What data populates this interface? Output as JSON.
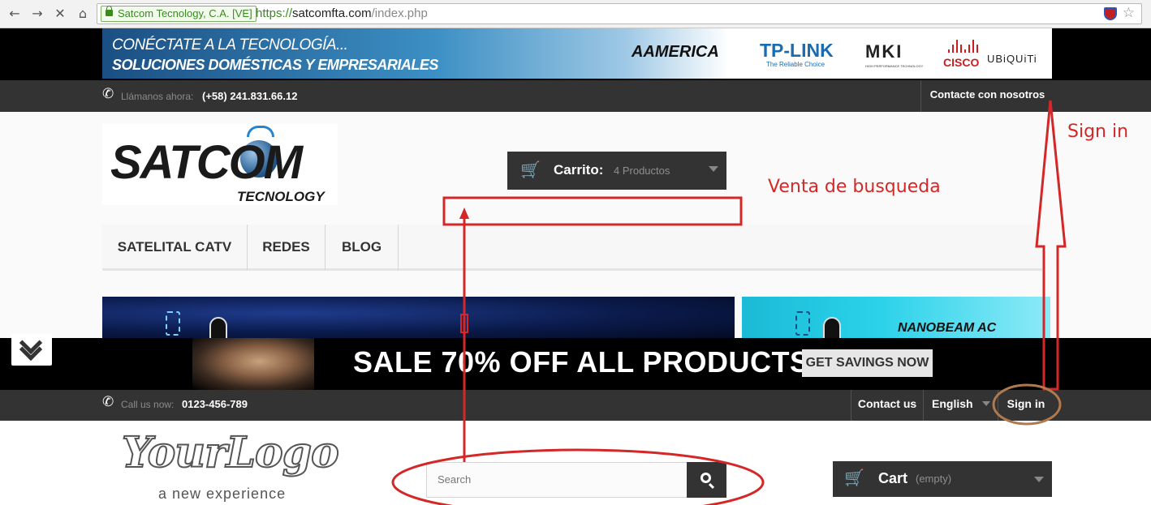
{
  "browser": {
    "ev_cert": "Satcom Tecnology, C.A. [VE]",
    "url_scheme": "https://",
    "url_host": "satcomfta.com",
    "url_path": "/index.php"
  },
  "site_live": {
    "promo_banner": {
      "tagline_1": "CONÉCTATE A LA TECNOLOGÍA...",
      "tagline_2": "SOLUCIONES DOMÉSTICAS Y EMPRESARIALES",
      "brands": {
        "aamerica": "AAMERICA",
        "tplink": "TP-LINK",
        "tplink_sub": "The Reliable Choice",
        "mki": "MKI",
        "mki_sub": "HIGH PERFORMANCE TECHNOLOGY",
        "cisco": "CISCO",
        "ubiquiti": "UBiQUiTi"
      }
    },
    "topbar": {
      "call_label": "Llámanos ahora:",
      "phone": "(+58) 241.831.66.12",
      "contact": "Contacte con nosotros"
    },
    "logo": {
      "name": "SATCOM",
      "sub": "TECNOLOGY"
    },
    "cart": {
      "label": "Carrito:",
      "count": "4 Productos"
    },
    "menu": [
      "SATELITAL CATV",
      "REDES",
      "BLOG"
    ],
    "slider": {
      "right_caption": "NANOBEAM AC"
    }
  },
  "site_theme": {
    "sale_banner": {
      "text": "SALE 70% OFF ALL PRODUCTS",
      "button": "GET SAVINGS NOW"
    },
    "topbar": {
      "call_label": "Call us now:",
      "phone": "0123-456-789",
      "contact": "Contact us",
      "language": "English",
      "sign_in": "Sign in"
    },
    "logo": {
      "name": "YourLogo",
      "tagline": "a new experience"
    },
    "search": {
      "placeholder": "Search"
    },
    "cart": {
      "label": "Cart",
      "count": "(empty)"
    }
  },
  "annotations": {
    "sign_in_note": "Sign in",
    "search_note": "Venta de busqueda",
    "color": "#d42828",
    "circle_color": "#b07a4e"
  },
  "colors": {
    "dark_bar": "#333333",
    "black_strip": "#000000"
  }
}
